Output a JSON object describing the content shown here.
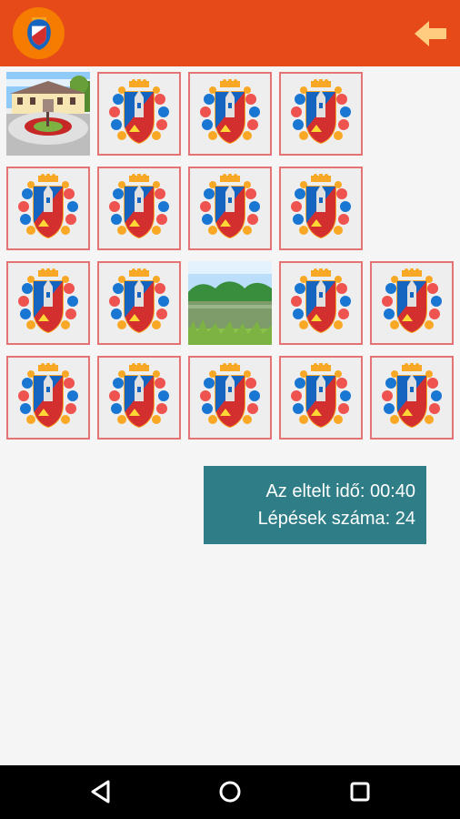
{
  "toolbar": {
    "logo_icon": "coat-of-arms-icon",
    "back_icon": "arrow-left-icon",
    "color": "#e64a19"
  },
  "board": {
    "rows": [
      [
        "photo-building",
        "crest",
        "crest",
        "crest"
      ],
      [
        "crest",
        "crest",
        "crest",
        "crest"
      ],
      [
        "crest",
        "crest",
        "photo-lake",
        "crest",
        "crest"
      ],
      [
        "crest",
        "crest",
        "crest",
        "crest",
        "crest"
      ]
    ]
  },
  "stats": {
    "elapsed_label": "Az eltelt idő: 00:40",
    "moves_label": "Lépések száma: 24",
    "color": "#2e7d87"
  },
  "navigation": {
    "back_icon": "triangle-back-icon",
    "home_icon": "circle-home-icon",
    "recents_icon": "square-recents-icon"
  }
}
